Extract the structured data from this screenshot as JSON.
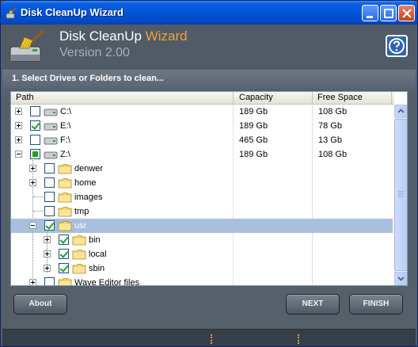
{
  "window": {
    "title": "Disk CleanUp Wizard"
  },
  "header": {
    "app_name": "Disk CleanUp",
    "app_accent": "Wizard",
    "version": "Version 2.00"
  },
  "section": {
    "title": "1. Select Drives or Folders to clean..."
  },
  "columns": {
    "path": "Path",
    "capacity": "Capacity",
    "free": "Free Space"
  },
  "rows": [
    {
      "label": "C:\\",
      "capacity": "189 Gb",
      "free": "108 Gb"
    },
    {
      "label": "E:\\",
      "capacity": "189 Gb",
      "free": "78 Gb"
    },
    {
      "label": "F:\\",
      "capacity": "465 Gb",
      "free": "13 Gb"
    },
    {
      "label": "Z:\\",
      "capacity": "189 Gb",
      "free": "108 Gb"
    },
    {
      "label": "denwer"
    },
    {
      "label": "home"
    },
    {
      "label": "images"
    },
    {
      "label": "tmp"
    },
    {
      "label": "usr"
    },
    {
      "label": "bin"
    },
    {
      "label": "local"
    },
    {
      "label": "sbin"
    },
    {
      "label": "Wave Editor files"
    }
  ],
  "buttons": {
    "about": "About",
    "next": "NEXT",
    "finish": "FINISH"
  },
  "colors": {
    "accent": "#f3a33b",
    "selection": "#a9bfe0",
    "check": "#21a121"
  }
}
